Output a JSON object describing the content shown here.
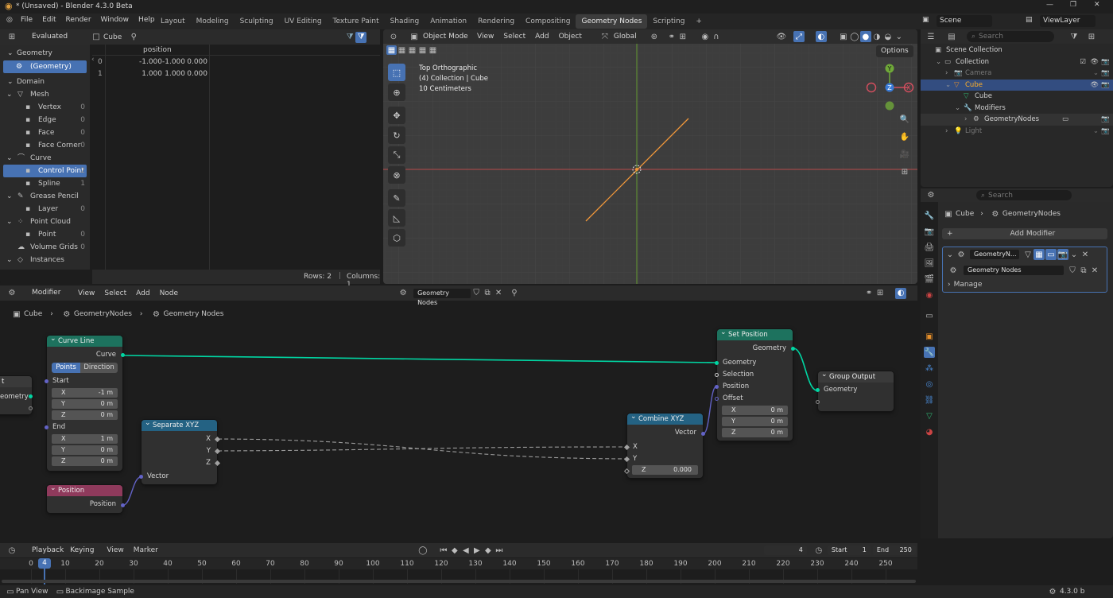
{
  "topbar": {
    "title": "* (Unsaved) - Blender 4.3.0 Beta",
    "menus": [
      "File",
      "Edit",
      "Render",
      "Window",
      "Help"
    ],
    "tabs": [
      "Layout",
      "Modeling",
      "Sculpting",
      "UV Editing",
      "Texture Paint",
      "Shading",
      "Animation",
      "Rendering",
      "Compositing",
      "Geometry Nodes",
      "Scripting"
    ],
    "active_tab": "Geometry Nodes",
    "add_tab": "+",
    "scene_label": "Scene",
    "viewlayer_label": "ViewLayer"
  },
  "spreadsheet": {
    "evaluated": "Evaluated",
    "object": "Cube",
    "column_header": "position",
    "rows": [
      {
        "i": "0",
        "x": "-1.000",
        "y": "-1.000",
        "z": "0.000"
      },
      {
        "i": "1",
        "x": "1.000",
        "y": "1.000",
        "z": "0.000"
      }
    ],
    "geometry_label": "Geometry",
    "geometry_item": "(Geometry)",
    "domain_label": "Domain",
    "domains": [
      {
        "label": "Mesh",
        "count": "",
        "level": 0
      },
      {
        "label": "Vertex",
        "count": "0",
        "level": 1
      },
      {
        "label": "Edge",
        "count": "0",
        "level": 1
      },
      {
        "label": "Face",
        "count": "0",
        "level": 1
      },
      {
        "label": "Face Corner",
        "count": "0",
        "level": 1
      },
      {
        "label": "Curve",
        "count": "",
        "level": 0
      },
      {
        "label": "Control Point",
        "count": "2",
        "level": 1,
        "active": true
      },
      {
        "label": "Spline",
        "count": "1",
        "level": 1
      },
      {
        "label": "Grease Pencil",
        "count": "",
        "level": 0
      },
      {
        "label": "Layer",
        "count": "0",
        "level": 1
      },
      {
        "label": "Point Cloud",
        "count": "",
        "level": 0
      },
      {
        "label": "Point",
        "count": "0",
        "level": 1
      },
      {
        "label": "Volume Grids",
        "count": "0",
        "level": 0
      },
      {
        "label": "Instances",
        "count": "",
        "level": 0
      }
    ],
    "rows_label": "Rows: 2",
    "cols_label": "Columns: 1"
  },
  "viewport": {
    "mode": "Object Mode",
    "menus": [
      "View",
      "Select",
      "Add",
      "Object"
    ],
    "orientation": "Global",
    "info": [
      "Top Orthographic",
      "(4) Collection | Cube",
      "10 Centimeters"
    ],
    "options": "Options",
    "gizmo": {
      "y": "Y",
      "z": "Z",
      "x": "X"
    }
  },
  "outliner": {
    "search": "Search",
    "items": [
      {
        "label": "Scene Collection",
        "level": 0
      },
      {
        "label": "Collection",
        "level": 1
      },
      {
        "label": "Camera",
        "level": 2,
        "dim": true
      },
      {
        "label": "Cube",
        "level": 2,
        "selected": true
      },
      {
        "label": "Cube",
        "level": 3
      },
      {
        "label": "Modifiers",
        "level": 3
      },
      {
        "label": "GeometryNodes",
        "level": 4
      },
      {
        "label": "Light",
        "level": 2,
        "dim": true
      }
    ]
  },
  "properties": {
    "search": "Search",
    "breadcrumb_obj": "Cube",
    "breadcrumb_mod": "GeometryNodes",
    "add_modifier": "Add Modifier",
    "modifier_name": "GeometryN...",
    "node_group": "Geometry Nodes",
    "manage": "Manage"
  },
  "node_editor": {
    "editor": "Modifier",
    "menus": [
      "View",
      "Select",
      "Add",
      "Node"
    ],
    "tree": "Geometry Nodes",
    "breadcrumb": [
      "Cube",
      "GeometryNodes",
      "Geometry Nodes"
    ],
    "nodes": {
      "curve_line": {
        "title": "Curve Line",
        "out": "Curve",
        "mode_a": "Points",
        "mode_b": "Direction",
        "start": "Start",
        "end": "End",
        "sx": "-1 m",
        "sy": "0 m",
        "sz": "0 m",
        "ex": "1 m",
        "ey": "0 m",
        "ez": "0 m"
      },
      "position": {
        "title": "Position",
        "out": "Position"
      },
      "separate": {
        "title": "Separate XYZ",
        "x": "X",
        "y": "Y",
        "z": "Z",
        "vector": "Vector"
      },
      "combine": {
        "title": "Combine XYZ",
        "vector": "Vector",
        "x": "X",
        "y": "Y",
        "z": "Z",
        "zval": "0.000"
      },
      "set_position": {
        "title": "Set Position",
        "geo_out": "Geometry",
        "geo_in": "Geometry",
        "selection": "Selection",
        "position": "Position",
        "offset": "Offset",
        "ox": "0 m",
        "oy": "0 m",
        "oz": "0 m"
      },
      "group_output": {
        "title": "Group Output",
        "geo": "Geometry"
      },
      "group_input": {
        "partial_title": "t",
        "geo": "eometry"
      }
    },
    "axis_labels": {
      "x": "X",
      "y": "Y",
      "z": "Z"
    }
  },
  "timeline": {
    "menus": [
      "Playback",
      "Keying",
      "View",
      "Marker"
    ],
    "current": "4",
    "start_label": "Start",
    "start": "1",
    "end_label": "End",
    "end": "250",
    "ticks": [
      "0",
      "10",
      "20",
      "30",
      "40",
      "50",
      "60",
      "70",
      "80",
      "90",
      "100",
      "110",
      "120",
      "130",
      "140",
      "150",
      "160",
      "170",
      "180",
      "190",
      "200",
      "210",
      "220",
      "230",
      "240",
      "250"
    ]
  },
  "status": {
    "left_a": "Pan View",
    "left_b": "Backimage Sample",
    "version": "4.3.0 b"
  },
  "colors": {
    "accent": "#4772b3",
    "curve_header": "#1d725e",
    "geo_socket": "#00d6a3",
    "vector_socket": "#6363c7",
    "float_socket": "#a1a1a1",
    "input_header": "#8f3a5c",
    "converter_header": "#246283"
  }
}
